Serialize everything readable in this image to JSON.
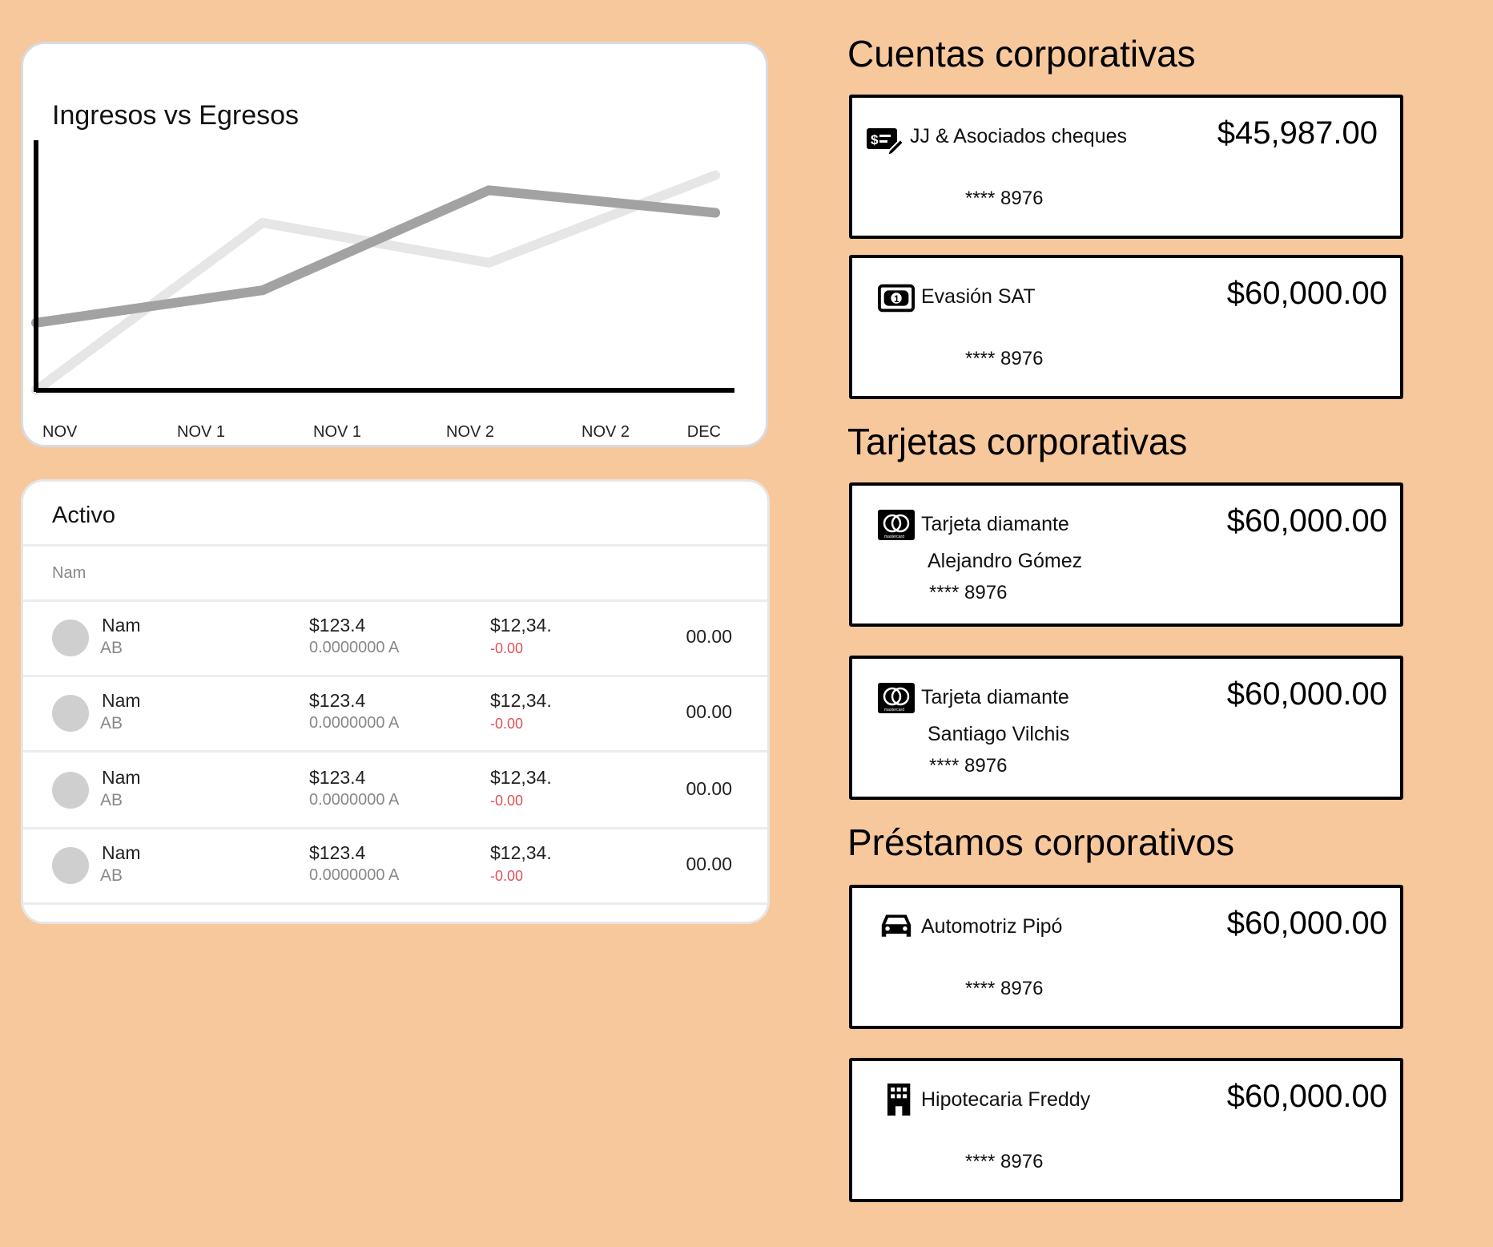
{
  "chart_data": {
    "type": "line",
    "title": "Ingresos vs Egresos",
    "categories": [
      "NOV",
      "NOV 1",
      "NOV 1",
      "NOV 2",
      "NOV 2",
      "DEC"
    ],
    "series": [
      {
        "values": [
          0,
          6.7,
          null,
          5.1,
          null,
          8.6
        ],
        "color": "#e6e6e6"
      },
      {
        "values": [
          2.7,
          4.0,
          null,
          8.0,
          null,
          7.1
        ],
        "color": "#a2a2a2"
      }
    ],
    "x_positions": [
      0,
      1,
      1.5,
      2,
      2.5,
      3
    ],
    "ylim": [
      0,
      10
    ],
    "grid": false
  },
  "table": {
    "title": "Activo",
    "header": "Nam",
    "rows": [
      {
        "name": "Nam",
        "sub": "AB",
        "v1": "$123.4",
        "v1_sub": "0.0000000 A",
        "v2": "$12,34.",
        "v2_sub": "-0.00",
        "v3": "00.00"
      },
      {
        "name": "Nam",
        "sub": "AB",
        "v1": "$123.4",
        "v1_sub": "0.0000000 A",
        "v2": "$12,34.",
        "v2_sub": "-0.00",
        "v3": "00.00"
      },
      {
        "name": "Nam",
        "sub": "AB",
        "v1": "$123.4",
        "v1_sub": "0.0000000 A",
        "v2": "$12,34.",
        "v2_sub": "-0.00",
        "v3": "00.00"
      },
      {
        "name": "Nam",
        "sub": "AB",
        "v1": "$123.4",
        "v1_sub": "0.0000000 A",
        "v2": "$12,34.",
        "v2_sub": "-0.00",
        "v3": "00.00"
      }
    ]
  },
  "accounts": {
    "title": "Cuentas corporativas",
    "items": [
      {
        "icon": "check-icon",
        "name": "JJ & Asociados cheques",
        "amount": "$45,987.00",
        "number": "**** 8976"
      },
      {
        "icon": "cash-icon",
        "name": "Evasión SAT",
        "amount": "$60,000.00",
        "number": "**** 8976"
      }
    ]
  },
  "cards": {
    "title": "Tarjetas corporativas",
    "items": [
      {
        "icon": "mastercard-icon",
        "brand_text": "mastercard",
        "name": "Tarjeta diamante",
        "holder": "Alejandro Gómez",
        "amount": "$60,000.00",
        "number": "**** 8976"
      },
      {
        "icon": "mastercard-icon",
        "brand_text": "mastercard",
        "name": "Tarjeta diamante",
        "holder": "Santiago Vilchis",
        "amount": "$60,000.00",
        "number": "**** 8976"
      }
    ]
  },
  "loans": {
    "title": "Préstamos corporativos",
    "items": [
      {
        "icon": "car-icon",
        "name": "Automotriz Pipó",
        "amount": "$60,000.00",
        "number": "**** 8976"
      },
      {
        "icon": "building-icon",
        "name": "Hipotecaria Freddy",
        "amount": "$60,000.00",
        "number": "**** 8976"
      }
    ]
  }
}
